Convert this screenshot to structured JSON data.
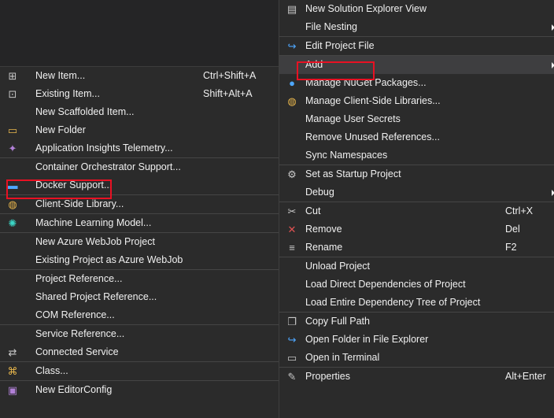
{
  "add_submenu": {
    "groups": [
      [
        {
          "label": "New Item...",
          "shortcut": "Ctrl+Shift+A",
          "icon": "new-item-icon"
        },
        {
          "label": "Existing Item...",
          "shortcut": "Shift+Alt+A",
          "icon": "existing-item-icon"
        },
        {
          "label": "New Scaffolded Item...",
          "shortcut": "",
          "icon": ""
        },
        {
          "label": "New Folder",
          "shortcut": "",
          "icon": "new-folder-icon"
        },
        {
          "label": "Application Insights Telemetry...",
          "shortcut": "",
          "icon": "app-insights-icon"
        }
      ],
      [
        {
          "label": "Container Orchestrator Support...",
          "shortcut": "",
          "icon": ""
        },
        {
          "label": "Docker Support...",
          "shortcut": "",
          "icon": "docker-icon"
        }
      ],
      [
        {
          "label": "Client-Side Library...",
          "shortcut": "",
          "icon": "client-library-icon"
        }
      ],
      [
        {
          "label": "Machine Learning Model...",
          "shortcut": "",
          "icon": "ml-model-icon"
        }
      ],
      [
        {
          "label": "New Azure WebJob Project",
          "shortcut": "",
          "icon": ""
        },
        {
          "label": "Existing Project as Azure WebJob",
          "shortcut": "",
          "icon": ""
        }
      ],
      [
        {
          "label": "Project Reference...",
          "shortcut": "",
          "icon": ""
        },
        {
          "label": "Shared Project Reference...",
          "shortcut": "",
          "icon": ""
        },
        {
          "label": "COM Reference...",
          "shortcut": "",
          "icon": ""
        }
      ],
      [
        {
          "label": "Service Reference...",
          "shortcut": "",
          "icon": ""
        },
        {
          "label": "Connected Service",
          "shortcut": "",
          "icon": "connected-service-icon"
        }
      ],
      [
        {
          "label": "Class...",
          "shortcut": "",
          "icon": "class-icon"
        }
      ],
      [
        {
          "label": "New EditorConfig",
          "shortcut": "",
          "icon": "editorconfig-icon"
        }
      ]
    ]
  },
  "context_menu": {
    "items": [
      {
        "label": "New Solution Explorer View",
        "icon": "solution-view-icon"
      },
      {
        "label": "File Nesting",
        "icon": "",
        "submenu": true
      },
      {
        "sep": true
      },
      {
        "label": "Edit Project File",
        "icon": "edit-project-icon"
      },
      {
        "sep": true
      },
      {
        "label": "Add",
        "icon": "",
        "submenu": true,
        "selected": true
      },
      {
        "label": "Manage NuGet Packages...",
        "icon": "nuget-icon"
      },
      {
        "label": "Manage Client-Side Libraries...",
        "icon": "client-library-icon"
      },
      {
        "label": "Manage User Secrets",
        "icon": ""
      },
      {
        "label": "Remove Unused References...",
        "icon": ""
      },
      {
        "label": "Sync Namespaces",
        "icon": ""
      },
      {
        "sep": true
      },
      {
        "label": "Set as Startup Project",
        "icon": "startup-gear-icon"
      },
      {
        "label": "Debug",
        "icon": "",
        "submenu": true
      },
      {
        "sep": true
      },
      {
        "label": "Cut",
        "icon": "cut-icon",
        "shortcut": "Ctrl+X"
      },
      {
        "label": "Remove",
        "icon": "remove-icon",
        "shortcut": "Del"
      },
      {
        "label": "Rename",
        "icon": "rename-icon",
        "shortcut": "F2"
      },
      {
        "sep": true
      },
      {
        "label": "Unload Project",
        "icon": ""
      },
      {
        "label": "Load Direct Dependencies of Project",
        "icon": ""
      },
      {
        "label": "Load Entire Dependency Tree of Project",
        "icon": ""
      },
      {
        "sep": true
      },
      {
        "label": "Copy Full Path",
        "icon": "copy-path-icon"
      },
      {
        "label": "Open Folder in File Explorer",
        "icon": "open-folder-icon"
      },
      {
        "label": "Open in Terminal",
        "icon": "terminal-icon"
      },
      {
        "sep": true
      },
      {
        "label": "Properties",
        "icon": "wrench-icon",
        "shortcut": "Alt+Enter"
      }
    ]
  },
  "highlight_color": "#e81123"
}
